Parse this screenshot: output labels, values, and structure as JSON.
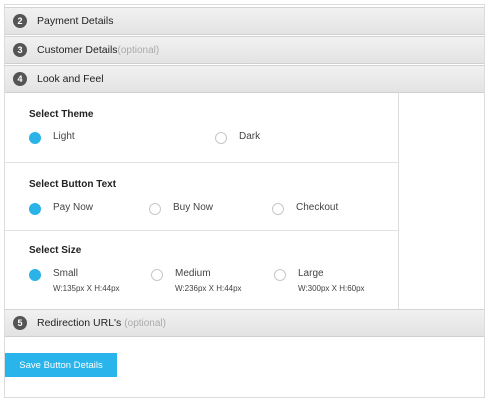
{
  "sections": [
    {
      "num": "2",
      "title": "Payment Details",
      "optional": ""
    },
    {
      "num": "3",
      "title": "Customer Details",
      "optional": "(optional)"
    },
    {
      "num": "4",
      "title": "Look and Feel",
      "optional": ""
    },
    {
      "num": "5",
      "title": "Redirection URL's",
      "optional": "(optional)"
    }
  ],
  "look": {
    "theme": {
      "title": "Select Theme",
      "options": [
        {
          "label": "Light",
          "checked": true
        },
        {
          "label": "Dark",
          "checked": false
        }
      ]
    },
    "button_text": {
      "title": "Select Button Text",
      "options": [
        {
          "label": "Pay Now",
          "checked": true
        },
        {
          "label": "Buy Now",
          "checked": false
        },
        {
          "label": "Checkout",
          "checked": false
        }
      ]
    },
    "size": {
      "title": "Select Size",
      "options": [
        {
          "label": "Small",
          "sub": "W:135px X H:44px",
          "checked": true
        },
        {
          "label": "Medium",
          "sub": "W:236px X H:44px",
          "checked": false
        },
        {
          "label": "Large",
          "sub": "W:300px X H:60px",
          "checked": false
        }
      ]
    }
  },
  "save_button": "Save Button Details",
  "colors": {
    "accent": "#29b4ec",
    "header_bg": "#e8e8e8"
  }
}
